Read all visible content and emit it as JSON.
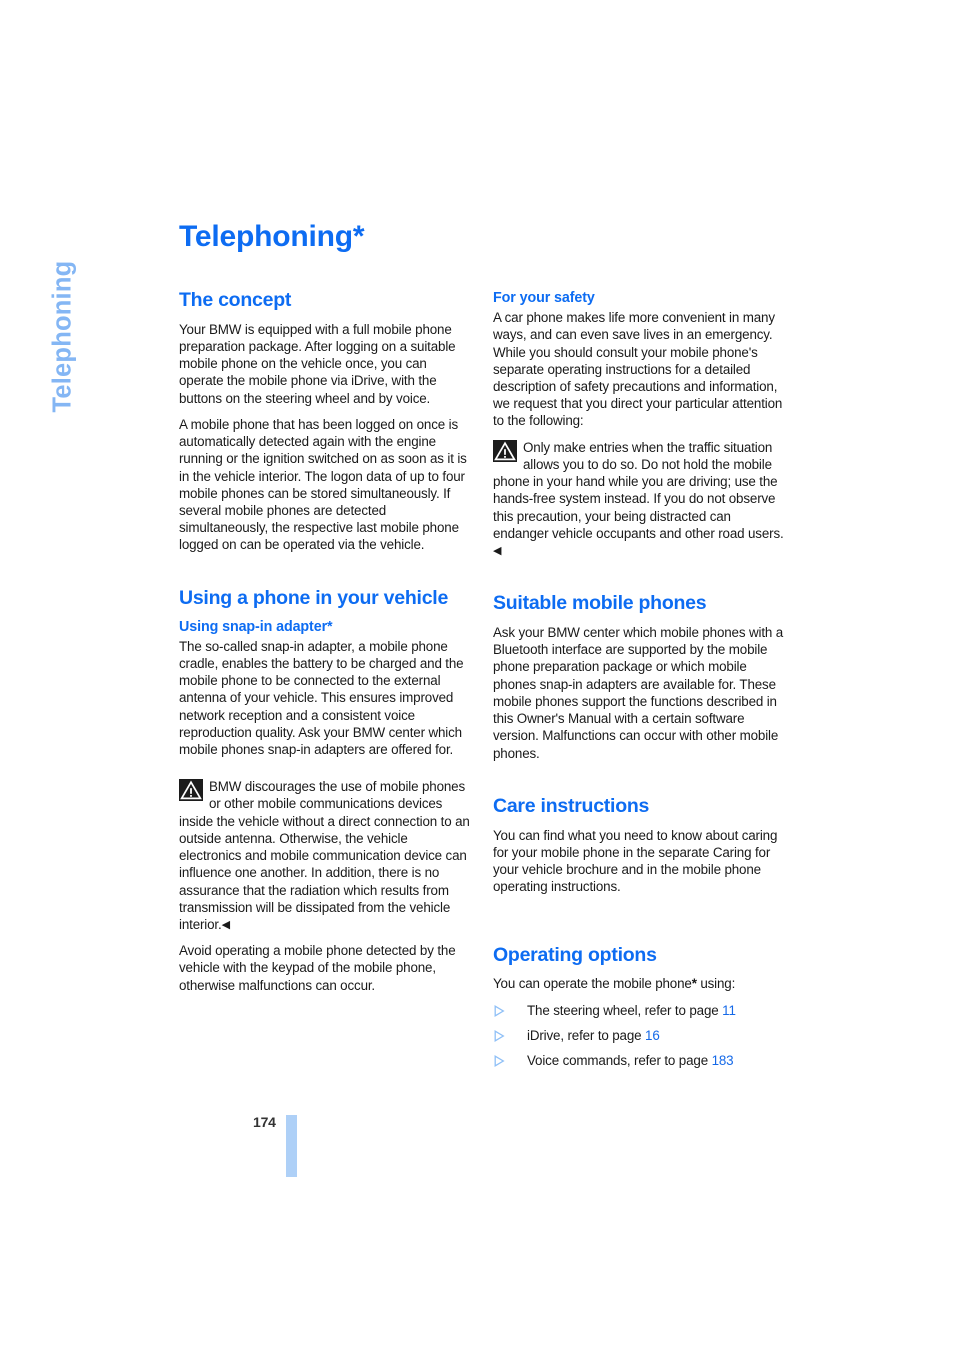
{
  "chapter_tab": {
    "label": "Telephoning"
  },
  "title": "Telephoning*",
  "left_column": {
    "section_concept": {
      "heading": "The concept",
      "paragraphs": [
        "Your BMW is equipped with a full mobile phone preparation package. After logging on a suitable mobile phone on the vehicle once, you can operate the mobile phone via iDrive, with the buttons on the steering wheel and by voice.",
        "A mobile phone that has been logged on once is automatically detected again with the engine running or the ignition switched on as soon as it is in the vehicle interior. The logon data of up to four mobile phones can be stored simultaneously. If several mobile phones are detected simultaneously, the respective last mobile phone logged on can be operated via the vehicle."
      ]
    },
    "section_using_phone": {
      "heading": "Using a phone in your vehicle",
      "subheading": "Using snap-in adapter*",
      "paragraph_1": "The so-called snap-in adapter, a mobile phone cradle, enables the battery to be charged and the mobile phone to be connected to the external antenna of your vehicle. This ensures improved network reception and a consistent voice reproduction quality. Ask your BMW center which mobile phones snap-in adapters are offered for.",
      "warning": "BMW discourages the use of mobile phones or other mobile communications devices inside the vehicle without a direct connection to an outside antenna. Otherwise, the vehicle electronics and mobile communication device can influence one another. In addition, there is no assurance that the radiation which results from transmission will be dissipated from the vehicle interior.",
      "warning_endmark": "◀",
      "paragraph_2": "Avoid operating a mobile phone detected by the vehicle with the keypad of the mobile phone, otherwise malfunctions can occur."
    }
  },
  "right_column": {
    "section_safety": {
      "heading": "For your safety",
      "paragraph": "A car phone makes life more convenient in many ways, and can even save lives in an emergency. While you should consult your mobile phone's separate operating instructions for a detailed description of safety precautions and information, we request that you direct your particular attention to the following:",
      "warning": "Only make entries when the traffic situation allows you to do so. Do not hold the mobile phone in your hand while you are driving; use the hands-free system instead. If you do not observe this precaution, your being distracted can endanger vehicle occupants and other road users.",
      "warning_endmark": "◀"
    },
    "section_suitable": {
      "heading": "Suitable mobile phones",
      "paragraph": "Ask your BMW center which mobile phones with a Bluetooth interface are supported by the mobile phone preparation package or which mobile phones snap-in adapters are available for. These mobile phones support the functions described in this Owner's Manual with a certain software version. Malfunctions can occur with other mobile phones."
    },
    "section_care": {
      "heading": "Care instructions",
      "paragraph": "You can find what you need to know about caring for your mobile phone in the separate Caring for your vehicle brochure and in the mobile phone operating instructions."
    },
    "section_operating": {
      "heading": "Operating options",
      "intro_before_asterisk": "You can operate the mobile phone",
      "intro_asterisk": "*",
      "intro_after_asterisk": " using:",
      "options": [
        {
          "text": "The steering wheel, refer to page ",
          "page": "11"
        },
        {
          "text": "iDrive, refer to page ",
          "page": "16"
        },
        {
          "text": "Voice commands, refer to page ",
          "page": "183"
        }
      ]
    }
  },
  "footer": {
    "page_number": "174"
  },
  "colors": {
    "heading_blue": "#0d6cf2",
    "tab_blue": "#84b6f4",
    "folio_bar_blue": "#aed0f7",
    "link_blue": "#1569e8",
    "body_text": "#1a1a1a"
  }
}
